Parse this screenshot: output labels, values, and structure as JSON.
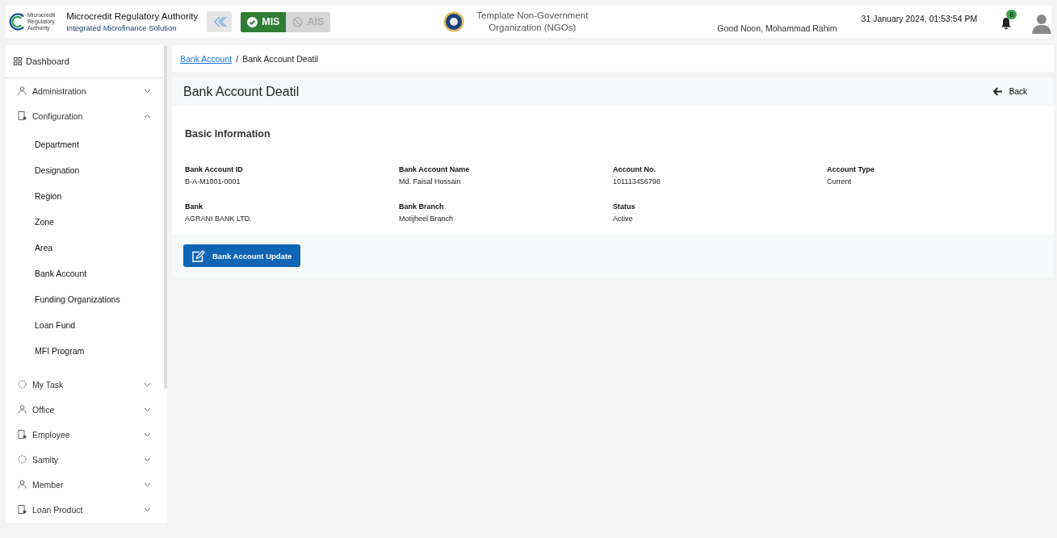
{
  "header": {
    "logo_lines": [
      "Microcredit",
      "Regulatory",
      "Authority"
    ],
    "org_name": "Microcredit Regulatory Authority",
    "tagline": "Integrated Microfinance Solution",
    "modules": [
      {
        "label": "MIS",
        "selected": true
      },
      {
        "label": "AIS",
        "selected": false
      }
    ],
    "ngo_name": "Template Non-Government Organization (NGOs)",
    "greeting": "Good Noon, Mohammad Rahim",
    "datetime": "31 January 2024, 01:53:54 PM",
    "notification_count": "8"
  },
  "sidebar": {
    "dashboard": "Dashboard",
    "items": [
      {
        "label": "Administration",
        "expanded": false
      },
      {
        "label": "Configuration",
        "expanded": true,
        "children": [
          {
            "label": "Department"
          },
          {
            "label": "Designation"
          },
          {
            "label": "Region"
          },
          {
            "label": "Zone"
          },
          {
            "label": "Area"
          },
          {
            "label": "Bank Account"
          },
          {
            "label": "Funding Organizations"
          },
          {
            "label": "Loan Fund"
          },
          {
            "label": "MFI Program"
          }
        ]
      },
      {
        "label": "My Task",
        "expanded": false
      },
      {
        "label": "Office",
        "expanded": false
      },
      {
        "label": "Employee",
        "expanded": false
      },
      {
        "label": "Samity",
        "expanded": false
      },
      {
        "label": "Member",
        "expanded": false
      },
      {
        "label": "Loan Product",
        "expanded": false
      }
    ]
  },
  "breadcrumb": [
    {
      "label": "Bank Account",
      "kind": "link"
    },
    {
      "label": "/",
      "kind": "separator"
    },
    {
      "label": "Bank Account Deatil",
      "kind": "current"
    }
  ],
  "page": {
    "title": "Bank Account Deatil",
    "back": "Back",
    "section_title": "Basic Information",
    "fields": [
      {
        "label": "Bank Account ID",
        "value": "B-A-M1001-0001"
      },
      {
        "label": "Bank Account Name",
        "value": "Md. Faisal Hossain"
      },
      {
        "label": "Account No.",
        "value": "101113456798"
      },
      {
        "label": "Account Type",
        "value": "Current"
      },
      {
        "label": "Bank",
        "value": "AGRANI BANK LTD."
      },
      {
        "label": "Bank Branch",
        "value": "Motijheel Branch"
      },
      {
        "label": "Status",
        "value": "Active"
      }
    ],
    "update_button": "Bank Account Update"
  }
}
